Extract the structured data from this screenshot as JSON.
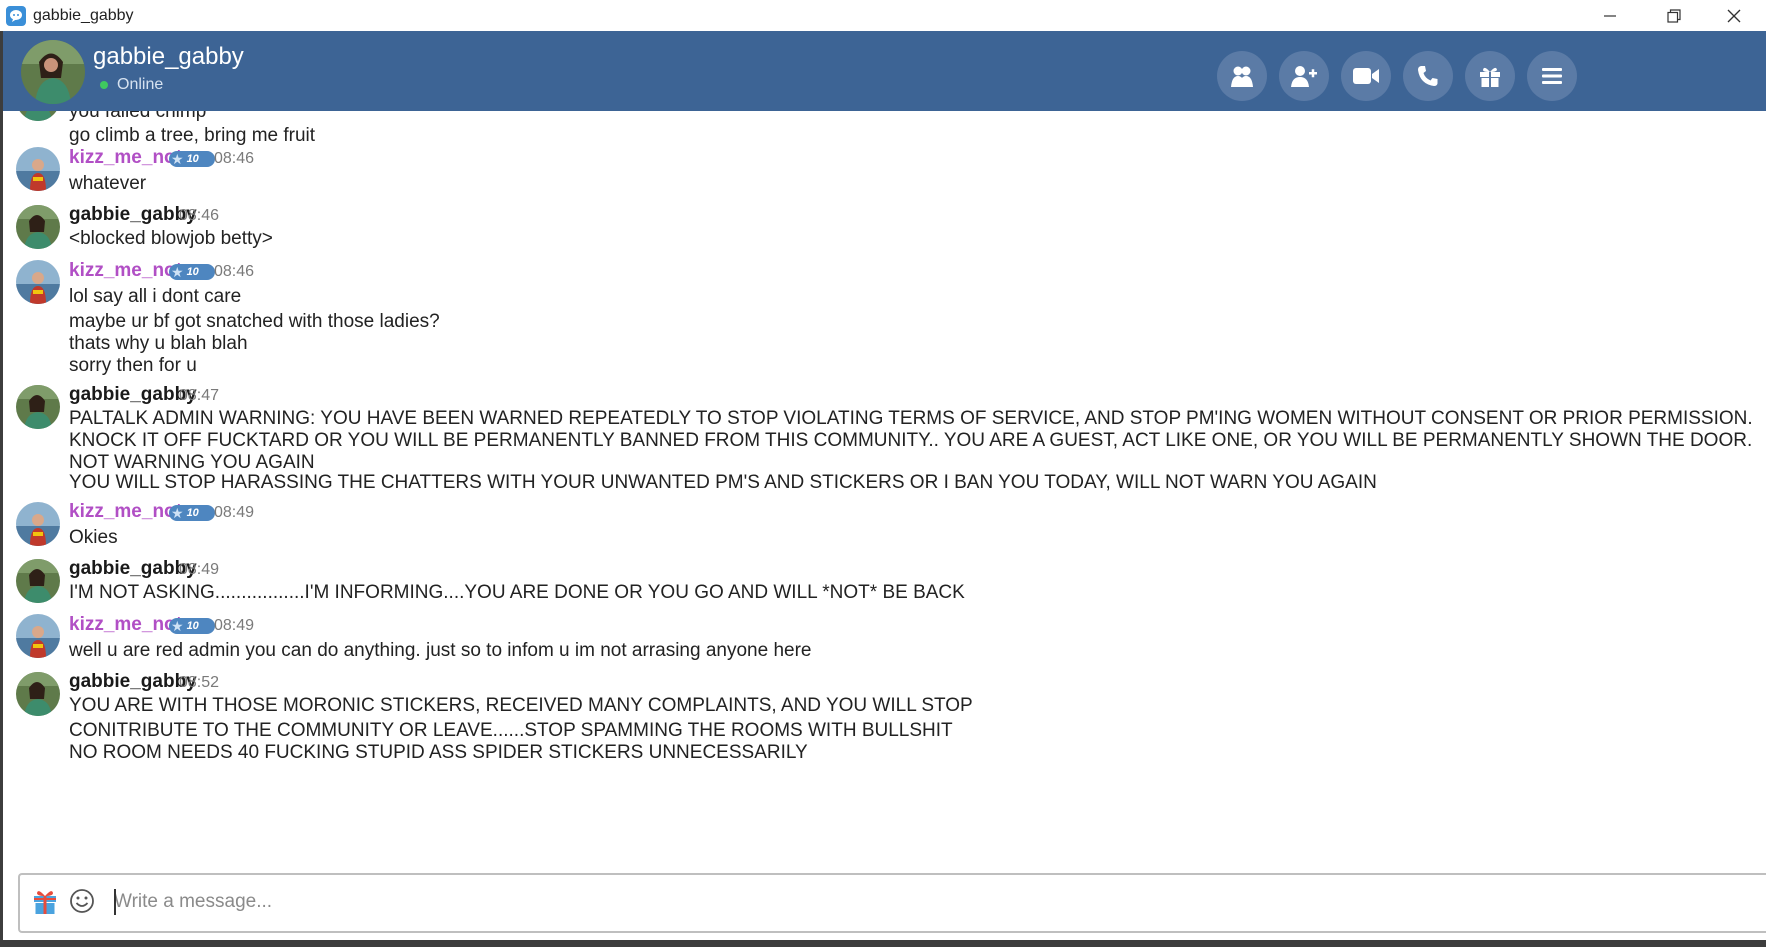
{
  "window": {
    "title": "gabbie_gabby"
  },
  "header": {
    "name": "gabbie_gabby",
    "status": "Online",
    "status_color": "#3fc95f",
    "buttons": [
      "group-icon",
      "add-user-icon",
      "video-icon",
      "phone-icon",
      "gift-icon",
      "menu-icon"
    ]
  },
  "messages": [
    {
      "lines": [
        "you failed chimp",
        "go climb a tree, bring me fruit"
      ]
    },
    {
      "nick": "kizz_me_not",
      "badge": "10",
      "time": "08:46",
      "lines": [
        "whatever"
      ]
    },
    {
      "nick": "gabbie_gabby",
      "time": "08:46",
      "lines": [
        "<blocked blowjob betty>"
      ]
    },
    {
      "nick": "kizz_me_not",
      "badge": "10",
      "time": "08:46",
      "lines": [
        "lol say all i dont care",
        "maybe ur bf got snatched with those ladies?",
        "thats why u blah blah",
        "sorry then for u"
      ]
    },
    {
      "nick": "gabbie_gabby",
      "time": "08:47",
      "lines": [
        "PALTALK ADMIN WARNING: YOU HAVE BEEN WARNED REPEATEDLY TO STOP VIOLATING TERMS OF SERVICE, AND STOP PM'ING WOMEN WITHOUT CONSENT OR PRIOR PERMISSION. KNOCK IT OFF FUCKTARD OR YOU WILL BE PERMANENTLY BANNED FROM THIS COMMUNITY.. YOU ARE A GUEST, ACT LIKE ONE, OR YOU WILL BE PERMANENTLY SHOWN THE DOOR. NOT WARNING YOU AGAIN",
        "YOU WILL STOP HARASSING THE CHATTERS WITH YOUR UNWANTED PM'S AND STICKERS OR I BAN YOU TODAY, WILL NOT WARN YOU AGAIN"
      ]
    },
    {
      "nick": "kizz_me_not",
      "badge": "10",
      "time": "08:49",
      "lines": [
        "Okies"
      ]
    },
    {
      "nick": "gabbie_gabby",
      "time": "08:49",
      "lines": [
        "I'M NOT ASKING.................I'M INFORMING....YOU ARE DONE OR YOU GO AND WILL *NOT* BE BACK"
      ]
    },
    {
      "nick": "kizz_me_not",
      "badge": "10",
      "time": "08:49",
      "lines": [
        "well u are red admin you can do anything. just so to infom u im not arrasing anyone here"
      ]
    },
    {
      "nick": "gabbie_gabby",
      "time": "08:52",
      "lines": [
        "YOU ARE WITH THOSE MORONIC STICKERS, RECEIVED MANY COMPLAINTS, AND YOU WILL STOP",
        "CONITRIBUTE TO THE COMMUNITY OR LEAVE......STOP SPAMMING THE ROOMS WITH BULLSHIT",
        "NO ROOM NEEDS 40 FUCKING STUPID ASS SPIDER STICKERS UNNECESSARILY"
      ]
    }
  ],
  "composer": {
    "placeholder": "Write a message..."
  },
  "colors": {
    "header_bg": "#3d6495",
    "guest_nick": "#b14fc5",
    "admin_nick": "#1a1a1a"
  }
}
